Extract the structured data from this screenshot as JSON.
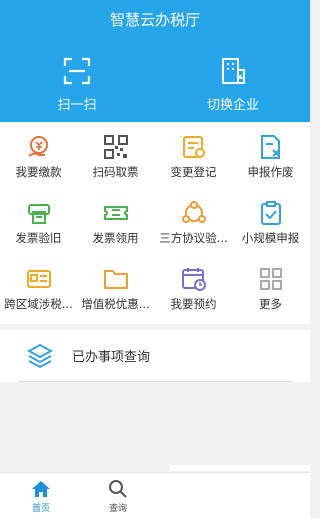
{
  "header": {
    "title": "智慧云办税厅"
  },
  "actions": [
    {
      "label": "扫一扫",
      "icon": "scan-icon"
    },
    {
      "label": "切换企业",
      "icon": "switch-company-icon"
    }
  ],
  "grid": [
    {
      "label": "我要缴款",
      "icon": "payment-icon"
    },
    {
      "label": "扫码取票",
      "icon": "qr-code-icon"
    },
    {
      "label": "变更登记",
      "icon": "change-register-icon"
    },
    {
      "label": "申报作废",
      "icon": "declaration-void-icon"
    },
    {
      "label": "发票验旧",
      "icon": "invoice-check-icon"
    },
    {
      "label": "发票领用",
      "icon": "invoice-receive-icon"
    },
    {
      "label": "三方协议验...",
      "icon": "tripartite-agreement-icon"
    },
    {
      "label": "小规模申报",
      "icon": "small-scale-declare-icon"
    },
    {
      "label": "跨区域涉税...",
      "icon": "cross-region-icon"
    },
    {
      "label": "增值税优惠...",
      "icon": "vat-preference-icon"
    },
    {
      "label": "我要预约",
      "icon": "appointment-icon"
    },
    {
      "label": "更多",
      "icon": "more-icon"
    }
  ],
  "query": {
    "label": "已办事项查询",
    "icon": "layers-icon"
  },
  "tabbar": [
    {
      "label": "首页",
      "icon": "home-icon",
      "active": true
    },
    {
      "label": "查询",
      "icon": "search-icon",
      "active": false
    }
  ],
  "colors": {
    "primary": "#27a5ea",
    "background": "#f2f2f2"
  }
}
